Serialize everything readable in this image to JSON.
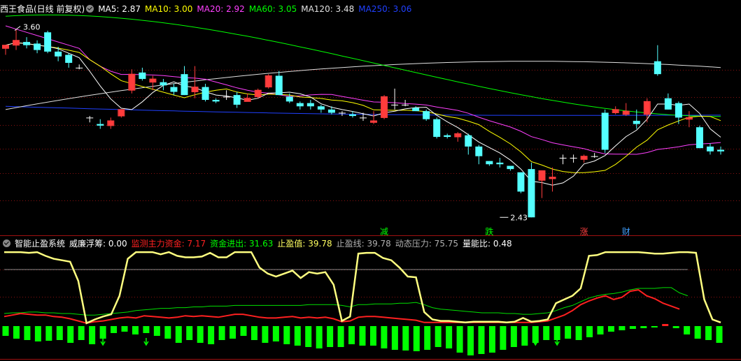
{
  "main_header": {
    "stock": "西王食品(日线 前复权)",
    "ma": [
      {
        "label": "MA5: 2.87",
        "color": "#ffffff"
      },
      {
        "label": "MA10: 3.00",
        "color": "#ffff00"
      },
      {
        "label": "MA20: 2.92",
        "color": "#ff40ff"
      },
      {
        "label": "MA60: 3.05",
        "color": "#00ff00"
      },
      {
        "label": "MA120: 3.48",
        "color": "#e0e0e0"
      },
      {
        "label": "MA250: 3.06",
        "color": "#2040ff"
      }
    ]
  },
  "sub_header": {
    "system": "智能止盈系统",
    "items": [
      {
        "label": "威廉浮筹: 0.00",
        "color": "#ffffff"
      },
      {
        "label": "监测主力资金: 7.17",
        "color": "#ff2020"
      },
      {
        "label": "资金进出: 31.63",
        "color": "#00ff00"
      },
      {
        "label": "止盈值: 39.78",
        "color": "#ffff60"
      },
      {
        "label": "止盈线: 39.78",
        "color": "#b0b0b0"
      },
      {
        "label": "动态压力: 75.75",
        "color": "#b0b0b0"
      },
      {
        "label": "量能比: 0.48",
        "color": "#ffffff"
      }
    ]
  },
  "colors": {
    "up": "#ff3c3c",
    "down": "#54ffff",
    "ma5": "#ffffff",
    "ma10": "#ffff00",
    "ma20": "#ff40ff",
    "ma60": "#00ff00",
    "ma120": "#e0e0e0",
    "ma250": "#2040ff",
    "grid": "#8a1010"
  },
  "chart_data": [
    {
      "type": "candlestick",
      "annotations": [
        {
          "text": "3.60",
          "index": 1,
          "price": 3.6,
          "kind": "high"
        },
        {
          "text": "2.43",
          "index": 47,
          "price": 2.43,
          "kind": "low"
        },
        {
          "text": "减",
          "index": 36,
          "color": "#00ff00"
        },
        {
          "text": "跌",
          "index": 46,
          "color": "#00ff00"
        },
        {
          "text": "涨",
          "index": 55,
          "color": "#ff4040"
        },
        {
          "text": "财",
          "index": 59,
          "color": "#40a0ff"
        }
      ],
      "candles": [
        [
          3.48,
          3.5,
          3.44,
          3.5
        ],
        [
          3.5,
          3.6,
          3.47,
          3.53
        ],
        [
          3.52,
          3.55,
          3.48,
          3.5
        ],
        [
          3.51,
          3.53,
          3.45,
          3.47
        ],
        [
          3.58,
          3.59,
          3.45,
          3.46
        ],
        [
          3.46,
          3.49,
          3.4,
          3.43
        ],
        [
          3.44,
          3.45,
          3.36,
          3.39
        ],
        [
          3.36,
          3.38,
          3.35,
          3.36
        ],
        [
          3.05,
          3.06,
          3.02,
          3.05
        ],
        [
          3.01,
          3.04,
          2.98,
          3.0
        ],
        [
          3.0,
          3.05,
          2.98,
          3.03
        ],
        [
          3.06,
          3.1,
          3.05,
          3.1
        ],
        [
          3.22,
          3.35,
          3.2,
          3.32
        ],
        [
          3.33,
          3.36,
          3.28,
          3.29
        ],
        [
          3.27,
          3.31,
          3.22,
          3.29
        ],
        [
          3.27,
          3.29,
          3.22,
          3.25
        ],
        [
          3.24,
          3.26,
          3.19,
          3.21
        ],
        [
          3.32,
          3.37,
          3.19,
          3.19
        ],
        [
          3.21,
          3.37,
          3.17,
          3.24
        ],
        [
          3.24,
          3.26,
          3.15,
          3.16
        ],
        [
          3.16,
          3.17,
          3.14,
          3.15
        ],
        [
          3.18,
          3.22,
          3.16,
          3.18
        ],
        [
          3.19,
          3.21,
          3.11,
          3.13
        ],
        [
          3.15,
          3.2,
          3.15,
          3.17
        ],
        [
          3.18,
          3.23,
          3.17,
          3.22
        ],
        [
          3.24,
          3.32,
          3.23,
          3.31
        ],
        [
          3.31,
          3.34,
          3.19,
          3.19
        ],
        [
          3.18,
          3.2,
          3.14,
          3.15
        ],
        [
          3.14,
          3.15,
          3.1,
          3.12
        ],
        [
          3.14,
          3.16,
          3.1,
          3.12
        ],
        [
          3.12,
          3.13,
          3.08,
          3.1
        ],
        [
          3.1,
          3.12,
          3.07,
          3.08
        ],
        [
          3.08,
          3.09,
          3.06,
          3.08
        ],
        [
          3.07,
          3.09,
          3.05,
          3.06
        ],
        [
          3.05,
          3.08,
          3.03,
          3.05
        ],
        [
          3.02,
          3.09,
          3.01,
          3.03
        ],
        [
          3.05,
          3.19,
          3.04,
          3.18
        ],
        [
          3.13,
          3.23,
          3.1,
          3.13
        ],
        [
          3.13,
          3.16,
          3.12,
          3.13
        ],
        [
          3.11,
          3.12,
          3.09,
          3.09
        ],
        [
          3.09,
          3.1,
          3.03,
          3.04
        ],
        [
          3.04,
          3.05,
          2.92,
          2.93
        ],
        [
          2.94,
          2.95,
          2.92,
          2.93
        ],
        [
          2.93,
          2.96,
          2.9,
          2.95
        ],
        [
          2.94,
          2.95,
          2.82,
          2.87
        ],
        [
          2.87,
          2.88,
          2.76,
          2.81
        ],
        [
          2.78,
          2.78,
          2.75,
          2.76
        ],
        [
          2.77,
          2.8,
          2.74,
          2.76
        ],
        [
          2.75,
          2.75,
          2.72,
          2.73
        ],
        [
          2.71,
          2.71,
          2.58,
          2.59
        ],
        [
          2.73,
          2.77,
          2.43,
          2.43
        ],
        [
          2.66,
          2.72,
          2.55,
          2.72
        ],
        [
          2.67,
          2.74,
          2.59,
          2.68
        ],
        [
          2.8,
          2.82,
          2.76,
          2.8
        ],
        [
          2.8,
          2.82,
          2.77,
          2.8
        ],
        [
          2.79,
          2.82,
          2.77,
          2.81
        ],
        [
          2.81,
          2.83,
          2.8,
          2.81
        ],
        [
          3.08,
          3.1,
          2.83,
          2.85
        ],
        [
          3.08,
          3.12,
          3.07,
          3.1
        ],
        [
          3.07,
          3.14,
          3.06,
          3.09
        ],
        [
          3.03,
          3.1,
          2.98,
          3.01
        ],
        [
          3.07,
          3.17,
          3.02,
          3.15
        ],
        [
          3.4,
          3.5,
          3.31,
          3.32
        ],
        [
          3.17,
          3.2,
          3.1,
          3.1
        ],
        [
          3.14,
          3.15,
          3.01,
          3.05
        ],
        [
          3.04,
          3.09,
          2.99,
          3.05
        ],
        [
          2.99,
          3.0,
          2.86,
          2.86
        ],
        [
          2.87,
          2.89,
          2.82,
          2.84
        ],
        [
          2.85,
          2.87,
          2.82,
          2.84
        ]
      ]
    },
    {
      "type": "indicator",
      "名": "智能止盈系统",
      "yellow": [
        99,
        99,
        99,
        98,
        99,
        94,
        90,
        88,
        86,
        60,
        3,
        8,
        12,
        15,
        40,
        90,
        99,
        99,
        99,
        96,
        99,
        94,
        92,
        92,
        93,
        98,
        92,
        92,
        99,
        99,
        99,
        78,
        70,
        66,
        70,
        74,
        64,
        72,
        70,
        72,
        55,
        6,
        12,
        97,
        98,
        98,
        91,
        88,
        78,
        66,
        65,
        18,
        8,
        6,
        6,
        5,
        4,
        5,
        5,
        5,
        5,
        4,
        5,
        10,
        5,
        6,
        8,
        30,
        35,
        40,
        50,
        94,
        95,
        99,
        99,
        99,
        99,
        99,
        98,
        97,
        97,
        98,
        99,
        99,
        98,
        35,
        8,
        4
      ],
      "red": [
        12,
        14,
        16,
        15,
        14,
        14,
        12,
        11,
        9,
        6,
        3,
        5,
        6,
        8,
        10,
        11,
        10,
        13,
        12,
        11,
        10,
        11,
        13,
        12,
        13,
        12,
        11,
        13,
        15,
        15,
        13,
        11,
        10,
        10,
        11,
        12,
        10,
        11,
        10,
        11,
        9,
        5,
        6,
        11,
        12,
        12,
        11,
        10,
        9,
        8,
        7,
        4,
        4,
        4,
        4,
        4,
        4,
        4,
        4,
        4,
        4,
        4,
        4,
        4,
        4,
        5,
        6,
        10,
        14,
        20,
        28,
        33,
        37,
        40,
        35,
        38,
        46,
        48,
        40,
        36,
        30,
        26,
        22
      ],
      "green": [
        16,
        17,
        17,
        18,
        18,
        17,
        17,
        16,
        16,
        15,
        14,
        14,
        15,
        16,
        17,
        18,
        20,
        21,
        22,
        23,
        23,
        24,
        24,
        25,
        25,
        26,
        26,
        26,
        27,
        27,
        27,
        27,
        27,
        27,
        27,
        27,
        27,
        28,
        28,
        28,
        28,
        27,
        25,
        28,
        28,
        29,
        29,
        29,
        30,
        30,
        31,
        28,
        24,
        22,
        21,
        20,
        19,
        18,
        17,
        17,
        17,
        16,
        16,
        15,
        15,
        16,
        17,
        20,
        24,
        27,
        32,
        37,
        40,
        42,
        43,
        45,
        48,
        50,
        50,
        50,
        51,
        51,
        44,
        40
      ],
      "gray": [
        32,
        32,
        32,
        32,
        32,
        32,
        32,
        32,
        32,
        32,
        32,
        32,
        32,
        32,
        32,
        32,
        32,
        32,
        32,
        32,
        32,
        32,
        32,
        32,
        32,
        32,
        32,
        32,
        32,
        32,
        32,
        32,
        32,
        32,
        32,
        32,
        32,
        32,
        32,
        32,
        32,
        32,
        32,
        32,
        32,
        32,
        32,
        32,
        32,
        32,
        32,
        32,
        32,
        32,
        32,
        32,
        32,
        32,
        32,
        32,
        32,
        32,
        32,
        32,
        32,
        32,
        32,
        32,
        32,
        32,
        32,
        32,
        32,
        32,
        32,
        32,
        32,
        32,
        32,
        32,
        32,
        32,
        32,
        32
      ],
      "bars": [
        -14,
        -18,
        -20,
        -22,
        -21,
        -20,
        -24,
        -20,
        -26,
        -18,
        -10,
        -8,
        -12,
        -10,
        -14,
        -18,
        -24,
        -20,
        -24,
        -26,
        -20,
        -18,
        -14,
        -20,
        -24,
        -22,
        -26,
        -28,
        -30,
        -32,
        -30,
        -30,
        -26,
        -28,
        -28,
        -32,
        -34,
        -35,
        -36,
        -34,
        -30,
        -32,
        -38,
        -42,
        -40,
        -38,
        -34,
        -30,
        -28,
        -24,
        -20,
        -20,
        -18,
        -20,
        -16,
        -12,
        -8,
        -6,
        -4,
        -3,
        -2,
        3,
        -3,
        -12,
        -18,
        -20,
        -24
      ],
      "arrows": [
        9,
        13,
        49,
        51
      ]
    }
  ]
}
